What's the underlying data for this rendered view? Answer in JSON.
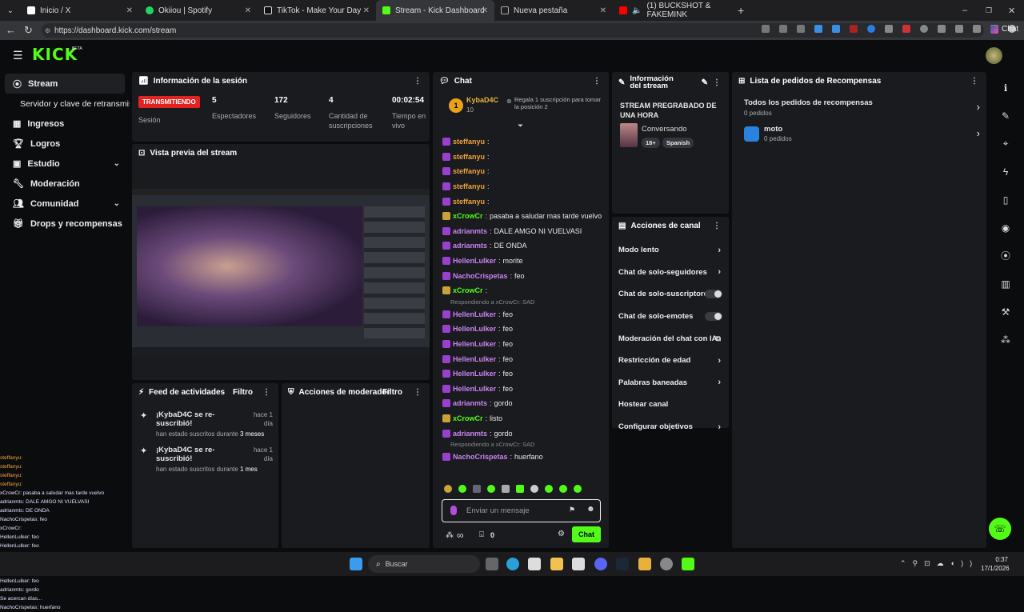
{
  "tabs": [
    {
      "label": "Inicio / X",
      "color": "#ffffff"
    },
    {
      "label": "Okiiou | Spotify",
      "color": "#1ed760"
    },
    {
      "label": "TikTok - Make Your Day",
      "color": "#ffffff"
    },
    {
      "label": "Stream - Kick Dashboard",
      "color": "#53fc18"
    },
    {
      "label": "Nueva pestaña",
      "color": "#aaaaaa"
    },
    {
      "label": "(1) BUCKSHOT & FAKEMINK",
      "color": "#ff0000"
    }
  ],
  "url": "https://dashboard.kick.com/stream",
  "chrome_chat": "Chat",
  "logo": "KICK",
  "logo_beta": "BETA",
  "sidebar": [
    {
      "label": "Stream",
      "icon": "broadcast-icon"
    },
    {
      "label": "Servidor y clave de retransmisión",
      "icon": ""
    },
    {
      "label": "Ingresos",
      "icon": "chart-icon"
    },
    {
      "label": "Logros",
      "icon": "trophy-icon"
    },
    {
      "label": "Estudio",
      "icon": "tv-icon",
      "chev": "⌄"
    },
    {
      "label": "Moderación",
      "icon": "wrench-icon"
    },
    {
      "label": "Comunidad",
      "icon": "users-icon",
      "chev": "⌄"
    },
    {
      "label": "Drops y recompensas",
      "icon": "gift-icon"
    }
  ],
  "session": {
    "title": "Información de la sesión",
    "status": "TRANSMITIENDO",
    "status_label": "Sesión",
    "viewers": "5",
    "viewers_label": "Espectadores",
    "followers": "172",
    "followers_label": "Seguidores",
    "subs": "4",
    "subs_label": "Cantidad de suscripciones",
    "time": "00:02:54",
    "time_label": "Tiempo en vivo"
  },
  "preview": {
    "title": "Vista previa del stream"
  },
  "feed": {
    "title": "Feed de actividades",
    "filter": "Filtro",
    "items": [
      {
        "title": "¡KybaD4C se re-suscribió!",
        "time": "hace 1 día",
        "desc_pre": "han estado suscritos durante ",
        "count": "3",
        "desc_post": " meses"
      },
      {
        "title": "¡KybaD4C se re-suscribió!",
        "time": "hace 1 día",
        "desc_pre": "han estado suscritos durante ",
        "count": "1",
        "desc_post": " mes"
      }
    ]
  },
  "modactions": {
    "title": "Acciones de moderador",
    "filter": "Filtro"
  },
  "chat": {
    "title": "Chat",
    "pin_user": "KybaD4C",
    "pin_count": "10",
    "pin_text": "Regala 1 suscripción para tomar la posición 2",
    "messages": [
      {
        "user": "steffanyu",
        "color": "#f2a23c",
        "text": ""
      },
      {
        "user": "steffanyu",
        "color": "#f2a23c",
        "text": ""
      },
      {
        "user": "steffanyu",
        "color": "#f2a23c",
        "text": ""
      },
      {
        "user": "steffanyu",
        "color": "#f2a23c",
        "text": ""
      },
      {
        "user": "steffanyu",
        "color": "#f2a23c",
        "text": ""
      },
      {
        "user": "xCrowCr",
        "color": "#53fc18",
        "text": "pasaba a saludar mas tarde vuelvo"
      },
      {
        "user": "adrianmts",
        "color": "#c983f0",
        "text": "DALE AMGO NI VUELVASI"
      },
      {
        "user": "adrianmts",
        "color": "#c983f0",
        "text": "DE ONDA"
      },
      {
        "user": "HellenLulker",
        "color": "#c983f0",
        "text": "morite"
      },
      {
        "user": "NachoCrispetas",
        "color": "#c983f0",
        "text": "feo"
      },
      {
        "user": "xCrowCr",
        "color": "#53fc18",
        "text": ""
      },
      {
        "reply": "Respondiendo a xCrowCr: SAD"
      },
      {
        "user": "HellenLulker",
        "color": "#c983f0",
        "text": "feo"
      },
      {
        "user": "HellenLulker",
        "color": "#c983f0",
        "text": "feo"
      },
      {
        "user": "HellenLulker",
        "color": "#c983f0",
        "text": "feo"
      },
      {
        "user": "HellenLulker",
        "color": "#c983f0",
        "text": "feo"
      },
      {
        "user": "HellenLulker",
        "color": "#c983f0",
        "text": "feo"
      },
      {
        "user": "HellenLulker",
        "color": "#c983f0",
        "text": "feo"
      },
      {
        "user": "adrianmts",
        "color": "#c983f0",
        "text": "gordo"
      },
      {
        "user": "xCrowCr",
        "color": "#53fc18",
        "text": "listo"
      },
      {
        "user": "adrianmts",
        "color": "#c983f0",
        "text": "gordo"
      },
      {
        "reply": "Respondiendo a xCrowCr: SAD"
      },
      {
        "user": "NachoCrispetas",
        "color": "#c983f0",
        "text": "huerfano"
      }
    ],
    "placeholder": "Enviar un mensaje",
    "send": "Chat",
    "count": "0",
    "infinity": "∞"
  },
  "info": {
    "title": "Información del stream",
    "stream_title": "STREAM PREGRABADO DE UNA HORA",
    "category": "Conversando",
    "tag1": "18+",
    "tag2": "Spanish"
  },
  "actions": {
    "title": "Acciones de canal",
    "rows": [
      {
        "label": "Modo lento",
        "type": "arrow"
      },
      {
        "label": "Chat de solo-seguidores",
        "type": "arrow"
      },
      {
        "label": "Chat de solo-suscriptores",
        "type": "toggle"
      },
      {
        "label": "Chat de solo-emotes",
        "type": "toggle"
      },
      {
        "label": "Moderación del chat con IA",
        "type": "ext"
      },
      {
        "label": "Restricción de edad",
        "type": "arrow"
      },
      {
        "label": "Palabras baneadas",
        "type": "arrow"
      },
      {
        "label": "Hostear canal",
        "type": "none"
      },
      {
        "label": "Configurar objetivos",
        "type": "arrow"
      }
    ]
  },
  "rewards": {
    "title": "Lista de pedidos de Recompensas",
    "all": "Todos los pedidos de recompensas",
    "all_count": "0 pedidos",
    "item": "moto",
    "item_count": "0 pedidos"
  },
  "taskbar": {
    "search": "Buscar",
    "time": "0:37",
    "date": "17/1/2026"
  },
  "overlay": [
    "steffanyu:",
    "steffanyu:",
    "steffanyu:",
    "steffanyu:",
    "xCrowCr: pasaba a saludar mas tarde vuelvo",
    "adrianmts: DALE AMGO NI VUELVASI",
    "adrianmts: DE ONDA",
    "NachoCrispetas: feo",
    "xCrowCr:",
    "HellenLulker: feo",
    "HellenLulker: feo",
    "HellenLulker: feo",
    "HellenLulker: feo",
    "HellenLulker: feo",
    "HellenLulker: feo",
    "adrianmts: gordo",
    "Se acercan días...",
    "NachoCrispetas: huerfano"
  ]
}
